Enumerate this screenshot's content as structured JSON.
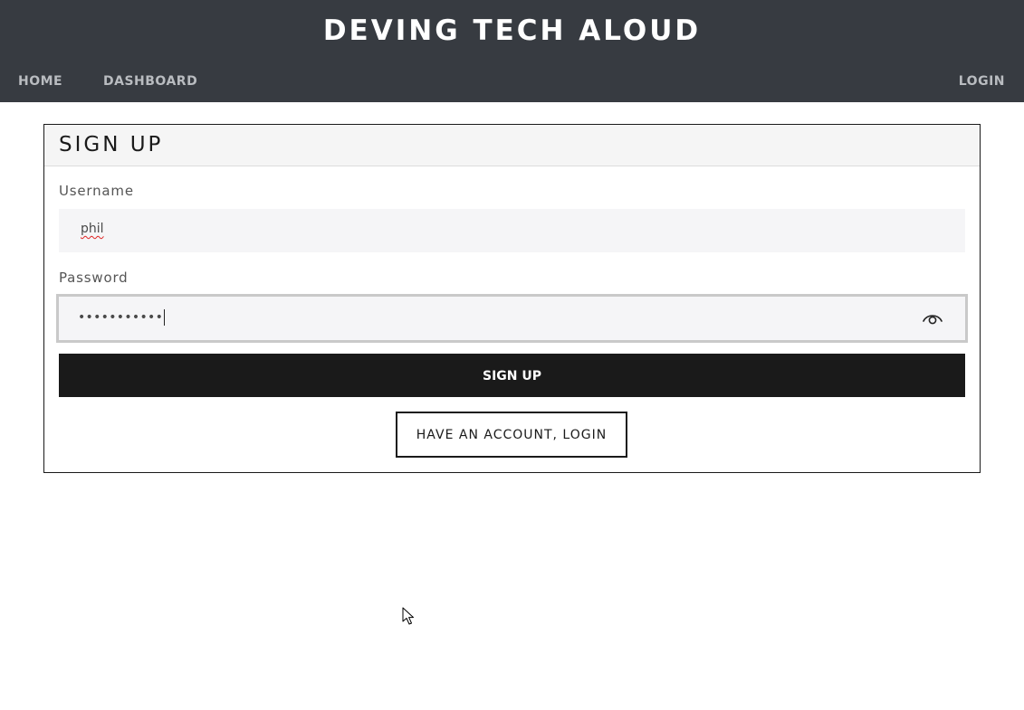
{
  "header": {
    "site_title": "DEVING TECH ALOUD",
    "nav": {
      "home": "HOME",
      "dashboard": "DASHBOARD",
      "login": "LOGIN"
    }
  },
  "form": {
    "title": "SIGN UP",
    "username_label": "Username",
    "username_value": "phil",
    "password_label": "Password",
    "password_mask": "•••••••••••",
    "submit_label": "SIGN UP",
    "login_link_label": "HAVE AN ACCOUNT, LOGIN"
  },
  "icons": {
    "password_toggle": "eye-icon",
    "mouse_cursor": "pointer-arrow-icon"
  },
  "colors": {
    "header_bg": "#373b41",
    "primary_button_bg": "#1a1a1a",
    "input_bg": "#f5f5f7"
  }
}
